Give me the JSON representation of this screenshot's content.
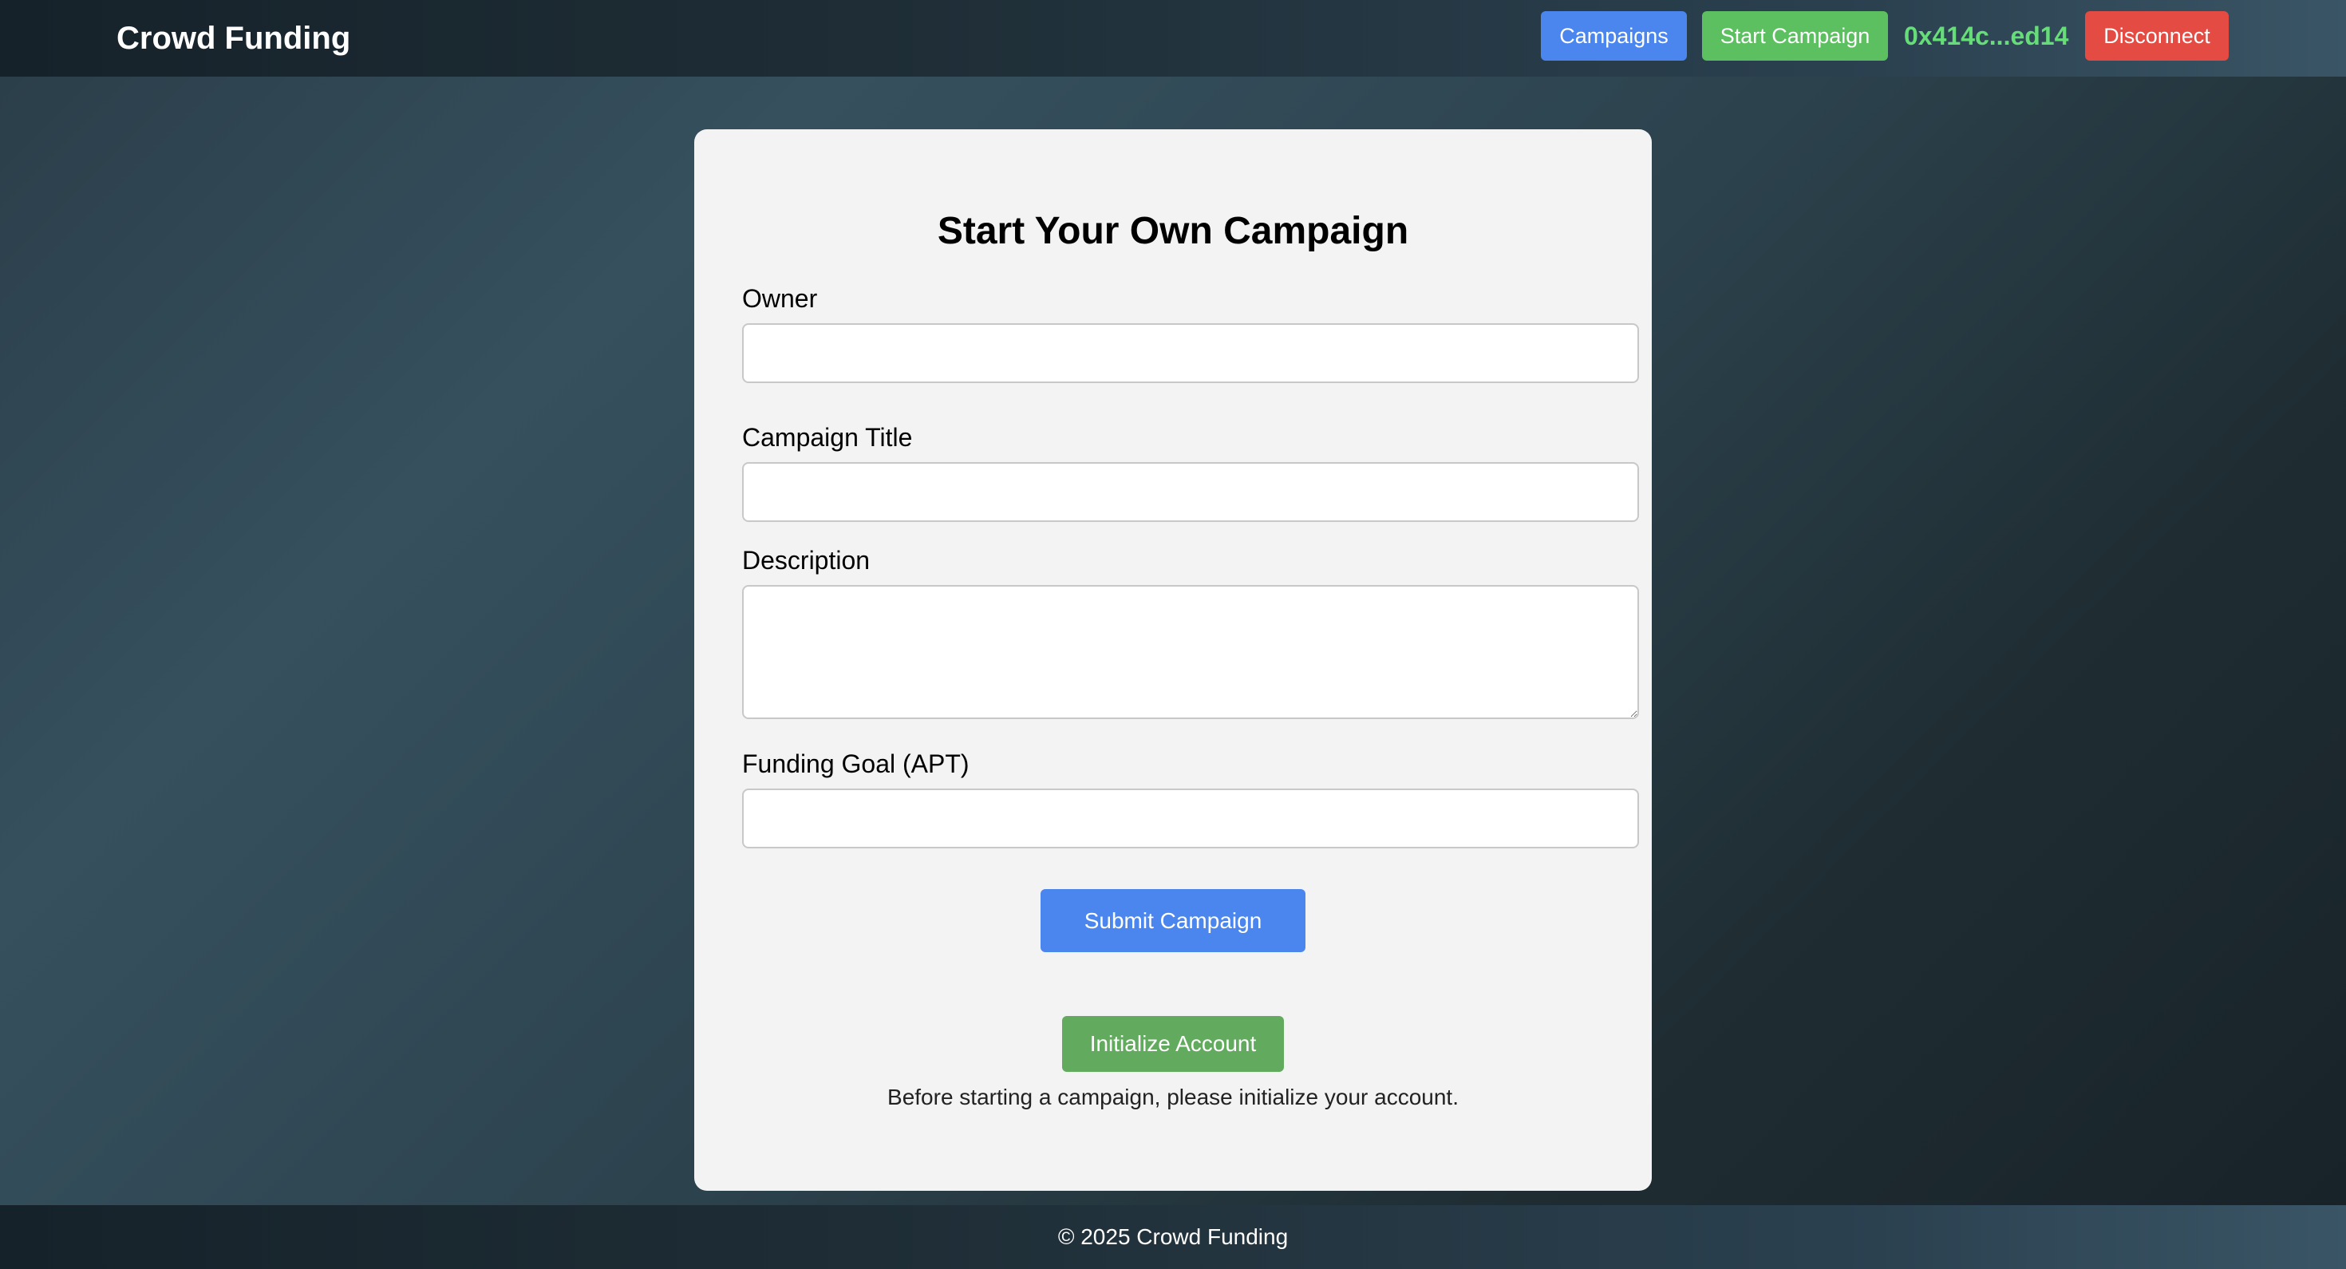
{
  "header": {
    "brand": "Crowd Funding",
    "nav": {
      "campaigns_label": "Campaigns",
      "start_campaign_label": "Start Campaign"
    },
    "wallet_address": "0x414c...ed14",
    "disconnect_label": "Disconnect"
  },
  "form": {
    "title": "Start Your Own Campaign",
    "fields": {
      "owner": {
        "label": "Owner",
        "value": "",
        "placeholder": ""
      },
      "campaign_title": {
        "label": "Campaign Title",
        "value": "",
        "placeholder": ""
      },
      "description": {
        "label": "Description",
        "value": "",
        "placeholder": ""
      },
      "funding_goal": {
        "label": "Funding Goal (APT)",
        "value": "",
        "placeholder": ""
      }
    },
    "submit_label": "Submit Campaign",
    "initialize_label": "Initialize Account",
    "initialize_hint": "Before starting a campaign, please initialize your account."
  },
  "footer": {
    "text": "© 2025 Crowd Funding"
  },
  "colors": {
    "primary_blue": "#4b85ee",
    "start_green": "#5dc060",
    "wallet_green": "#66dd78",
    "disconnect_red": "#e44b42",
    "init_green": "#62ab5e",
    "card_bg": "#f3f3f3"
  }
}
